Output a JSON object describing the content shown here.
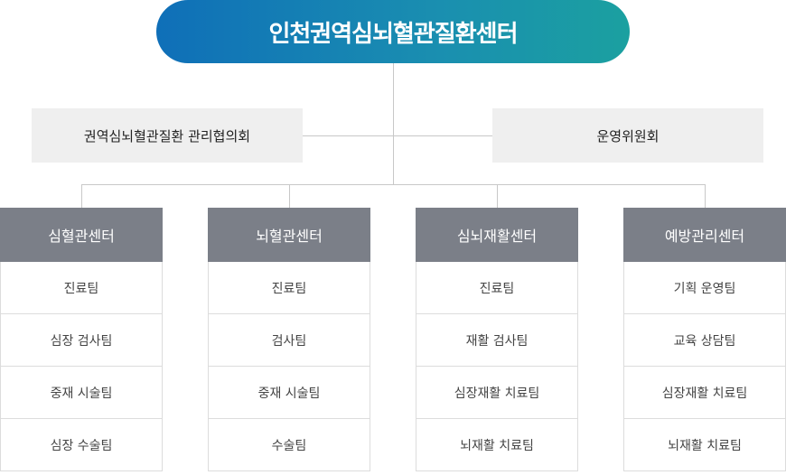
{
  "top": {
    "title": "인천권역심뇌혈관질환센터"
  },
  "side_left": {
    "label": "권역심뇌혈관질환 관리협의회"
  },
  "side_right": {
    "label": "운영위원회"
  },
  "columns": [
    {
      "title": "심혈관센터",
      "teams": [
        "진료팀",
        "심장 검사팀",
        "중재 시술팀",
        "심장 수술팀"
      ]
    },
    {
      "title": "뇌혈관센터",
      "teams": [
        "진료팀",
        "검사팀",
        "중재 시술팀",
        "수술팀"
      ]
    },
    {
      "title": "심뇌재활센터",
      "teams": [
        "진료팀",
        "재활 검사팀",
        "심장재활 치료팀",
        "뇌재활 치료팀"
      ]
    },
    {
      "title": "예방관리센터",
      "teams": [
        "기획 운영팀",
        "교육 상담팀",
        "심장재활 치료팀",
        "뇌재활 치료팀"
      ]
    }
  ]
}
